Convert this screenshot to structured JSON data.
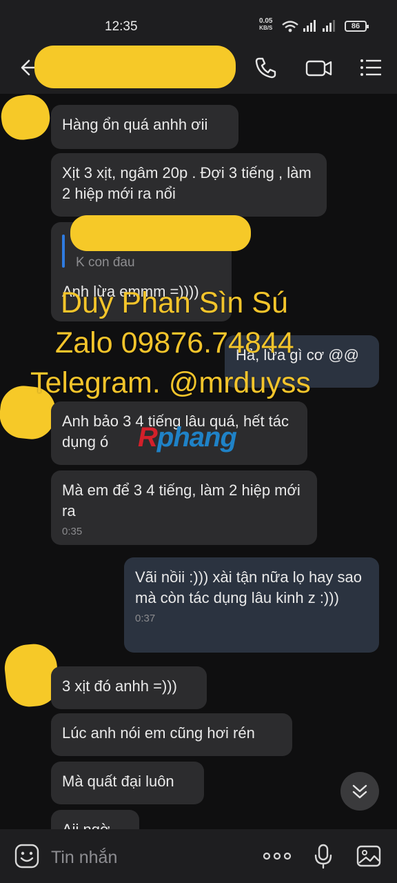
{
  "status_bar": {
    "time": "12:35",
    "net_speed_value": "0.05",
    "net_speed_unit": "KB/S",
    "battery": "86"
  },
  "header": {
    "back_icon": "arrow-left-icon",
    "call_icon": "phone-icon",
    "video_icon": "video-camera-icon",
    "menu_icon": "list-menu-icon"
  },
  "messages": [
    {
      "direction": "in",
      "text": "Hàng ổn quá anhh ơii"
    },
    {
      "direction": "in",
      "text": "Xịt 3 xịt, ngâm 20p . Đợi 3 tiếng , làm 2 hiệp mới ra nổi"
    },
    {
      "direction": "in",
      "quote_text": "K con đau",
      "text": "Anh lừa emmm =))))"
    },
    {
      "direction": "out",
      "text": "Hả, lừa gì cơ @@"
    },
    {
      "direction": "in",
      "text": "Anh bảo 3 4 tiếng lâu quá, hết tác dụng ó"
    },
    {
      "direction": "in",
      "text": "Mà em để 3 4 tiếng, làm 2 hiệp mới ra",
      "time": "0:35"
    },
    {
      "direction": "out",
      "text": "Vãi nồii :))) xài tận nữa lọ hay sao mà còn tác dụng lâu kinh z :)))",
      "time": "0:37"
    },
    {
      "direction": "in",
      "text": "3 xịt đó anhh =)))"
    },
    {
      "direction": "in",
      "text": "Lúc anh nói em cũng hơi rén"
    },
    {
      "direction": "in",
      "text": "Mà quất đại luôn"
    },
    {
      "direction": "in",
      "text": "Aii ngờ..."
    }
  ],
  "watermark": {
    "line1": "Duy Phan Sìn Sú",
    "line2": "Zalo 09876.74844",
    "line3": "Telegram. @mrduyss",
    "logo_r": "R",
    "logo_rest": "phang"
  },
  "input_bar": {
    "placeholder": "Tin nhắn",
    "emoji_icon": "emoji-face-icon",
    "more_icon": "more-dots-icon",
    "mic_icon": "microphone-icon",
    "image_icon": "image-gallery-icon"
  },
  "scroll_button_icon": "double-chevron-down-icon",
  "colors": {
    "background": "#0f0f10",
    "incoming_bubble": "#2c2c2e",
    "outgoing_bubble": "#2b3340",
    "watermark": "#f3c42b",
    "redaction": "#f6c928"
  }
}
